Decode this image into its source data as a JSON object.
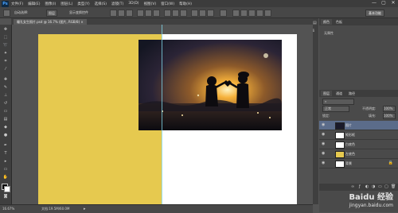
{
  "app": {
    "logo": "Ps"
  },
  "menu": [
    "文件(F)",
    "编辑(E)",
    "图像(I)",
    "图层(L)",
    "类型(Y)",
    "选择(S)",
    "滤镜(T)",
    "3D(D)",
    "视图(V)",
    "窗口(W)",
    "帮助(H)"
  ],
  "window_controls": [
    "—",
    "▢",
    "✕"
  ],
  "options": {
    "auto_select": "自动选择:",
    "auto_select_value": "图层",
    "show_transform": "显示变换控件",
    "workspace": "基本功能"
  },
  "document_tab": "瞳孔女生照片.psd @ 16.7% (图片, RGB/8) ×",
  "status": {
    "zoom": "16.67%",
    "doc_info": "文档:19.5M/60.0M"
  },
  "panels": {
    "top_tabs": [
      "颜色",
      "色板"
    ],
    "properties_label": "无属性",
    "layers_tabs": [
      "图层",
      "通道",
      "路径"
    ],
    "blend_mode": "正常",
    "opacity_label": "不透明度:",
    "opacity_value": "100%",
    "lock_label": "锁定:",
    "fill_label": "填充:",
    "fill_value": "100%",
    "layers": [
      {
        "name": "图片",
        "selected": true,
        "thumb": "#1a1a2a"
      },
      {
        "name": "矩形框",
        "selected": false,
        "thumb": "#ffffff"
      },
      {
        "name": "白底色",
        "selected": false,
        "thumb": "#ffffff"
      },
      {
        "name": "左底色",
        "selected": false,
        "thumb": "#e6c94f"
      },
      {
        "name": "背景",
        "selected": false,
        "thumb": "#ffffff"
      }
    ]
  },
  "watermark": {
    "line1": "Baidu 经验",
    "line2": "jingyan.baidu.com"
  },
  "colors": {
    "yellow": "#e6c94f",
    "ps_blue": "#4aa3ff",
    "selected_layer": "#5b6c8a"
  }
}
